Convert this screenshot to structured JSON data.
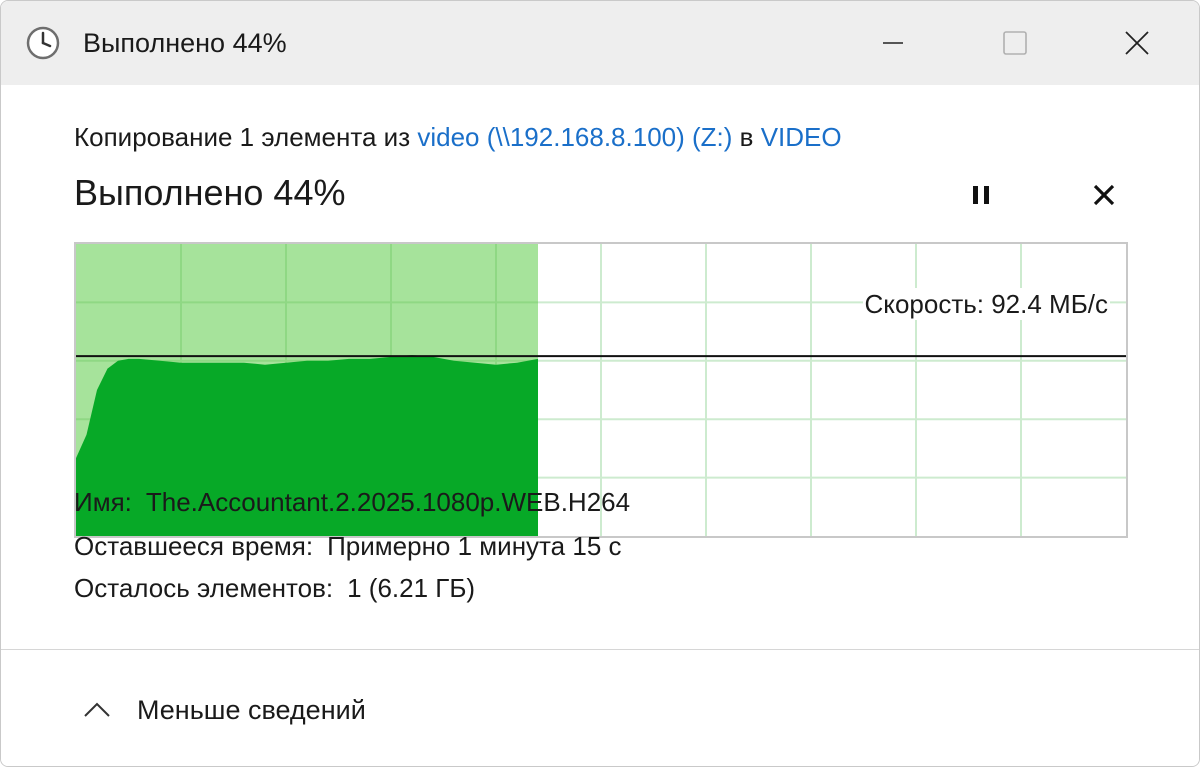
{
  "window": {
    "title": "Выполнено 44%"
  },
  "copy_info": {
    "prefix": "Копирование 1 элемента из ",
    "source_link": "video (\\\\192.168.8.100) (Z:)",
    "middle": " в ",
    "dest_link": "VIDEO"
  },
  "progress": {
    "title": "Выполнено 44%",
    "percent": 44,
    "speed_label": "Скорость: 92.4 МБ/с",
    "speed_mbps": 92.4
  },
  "details": {
    "name_label": "Имя:",
    "name_value": "The.Accountant.2.2025.1080p.WEB.H264",
    "time_label": "Оставшееся время:",
    "time_value": "Примерно 1 минута 15 с",
    "items_label": "Осталось элементов:",
    "items_value": "1 (6.21 ГБ)"
  },
  "footer": {
    "toggle_label": "Меньше сведений"
  },
  "icons": {
    "app": "clock-icon",
    "minimize": "minimize-icon",
    "maximize": "maximize-icon",
    "close": "close-icon",
    "pause": "pause-icon",
    "cancel": "cancel-icon",
    "collapse": "chevron-up-icon"
  },
  "colors": {
    "link": "#1a6fc9",
    "graph_fill_dark": "#07a927",
    "graph_fill_light": "#a6e39b",
    "graph_grid": "#cdebcf",
    "titlebar": "#eeeeee"
  },
  "chart_data": {
    "type": "area",
    "title": "",
    "xlabel": "",
    "ylabel": "",
    "progress_fraction": 0.44,
    "current_speed_line": 92.4,
    "ylim": [
      0,
      150
    ],
    "x": [
      0,
      0.01,
      0.02,
      0.03,
      0.04,
      0.05,
      0.06,
      0.08,
      0.1,
      0.12,
      0.14,
      0.16,
      0.18,
      0.2,
      0.22,
      0.24,
      0.26,
      0.28,
      0.3,
      0.32,
      0.34,
      0.36,
      0.38,
      0.4,
      0.42,
      0.44
    ],
    "values": [
      40,
      52,
      75,
      86,
      90,
      91,
      91,
      90,
      89,
      89,
      89,
      89,
      88,
      89,
      90,
      90,
      91,
      91,
      92,
      93,
      92,
      90,
      89,
      88,
      89,
      91
    ]
  }
}
